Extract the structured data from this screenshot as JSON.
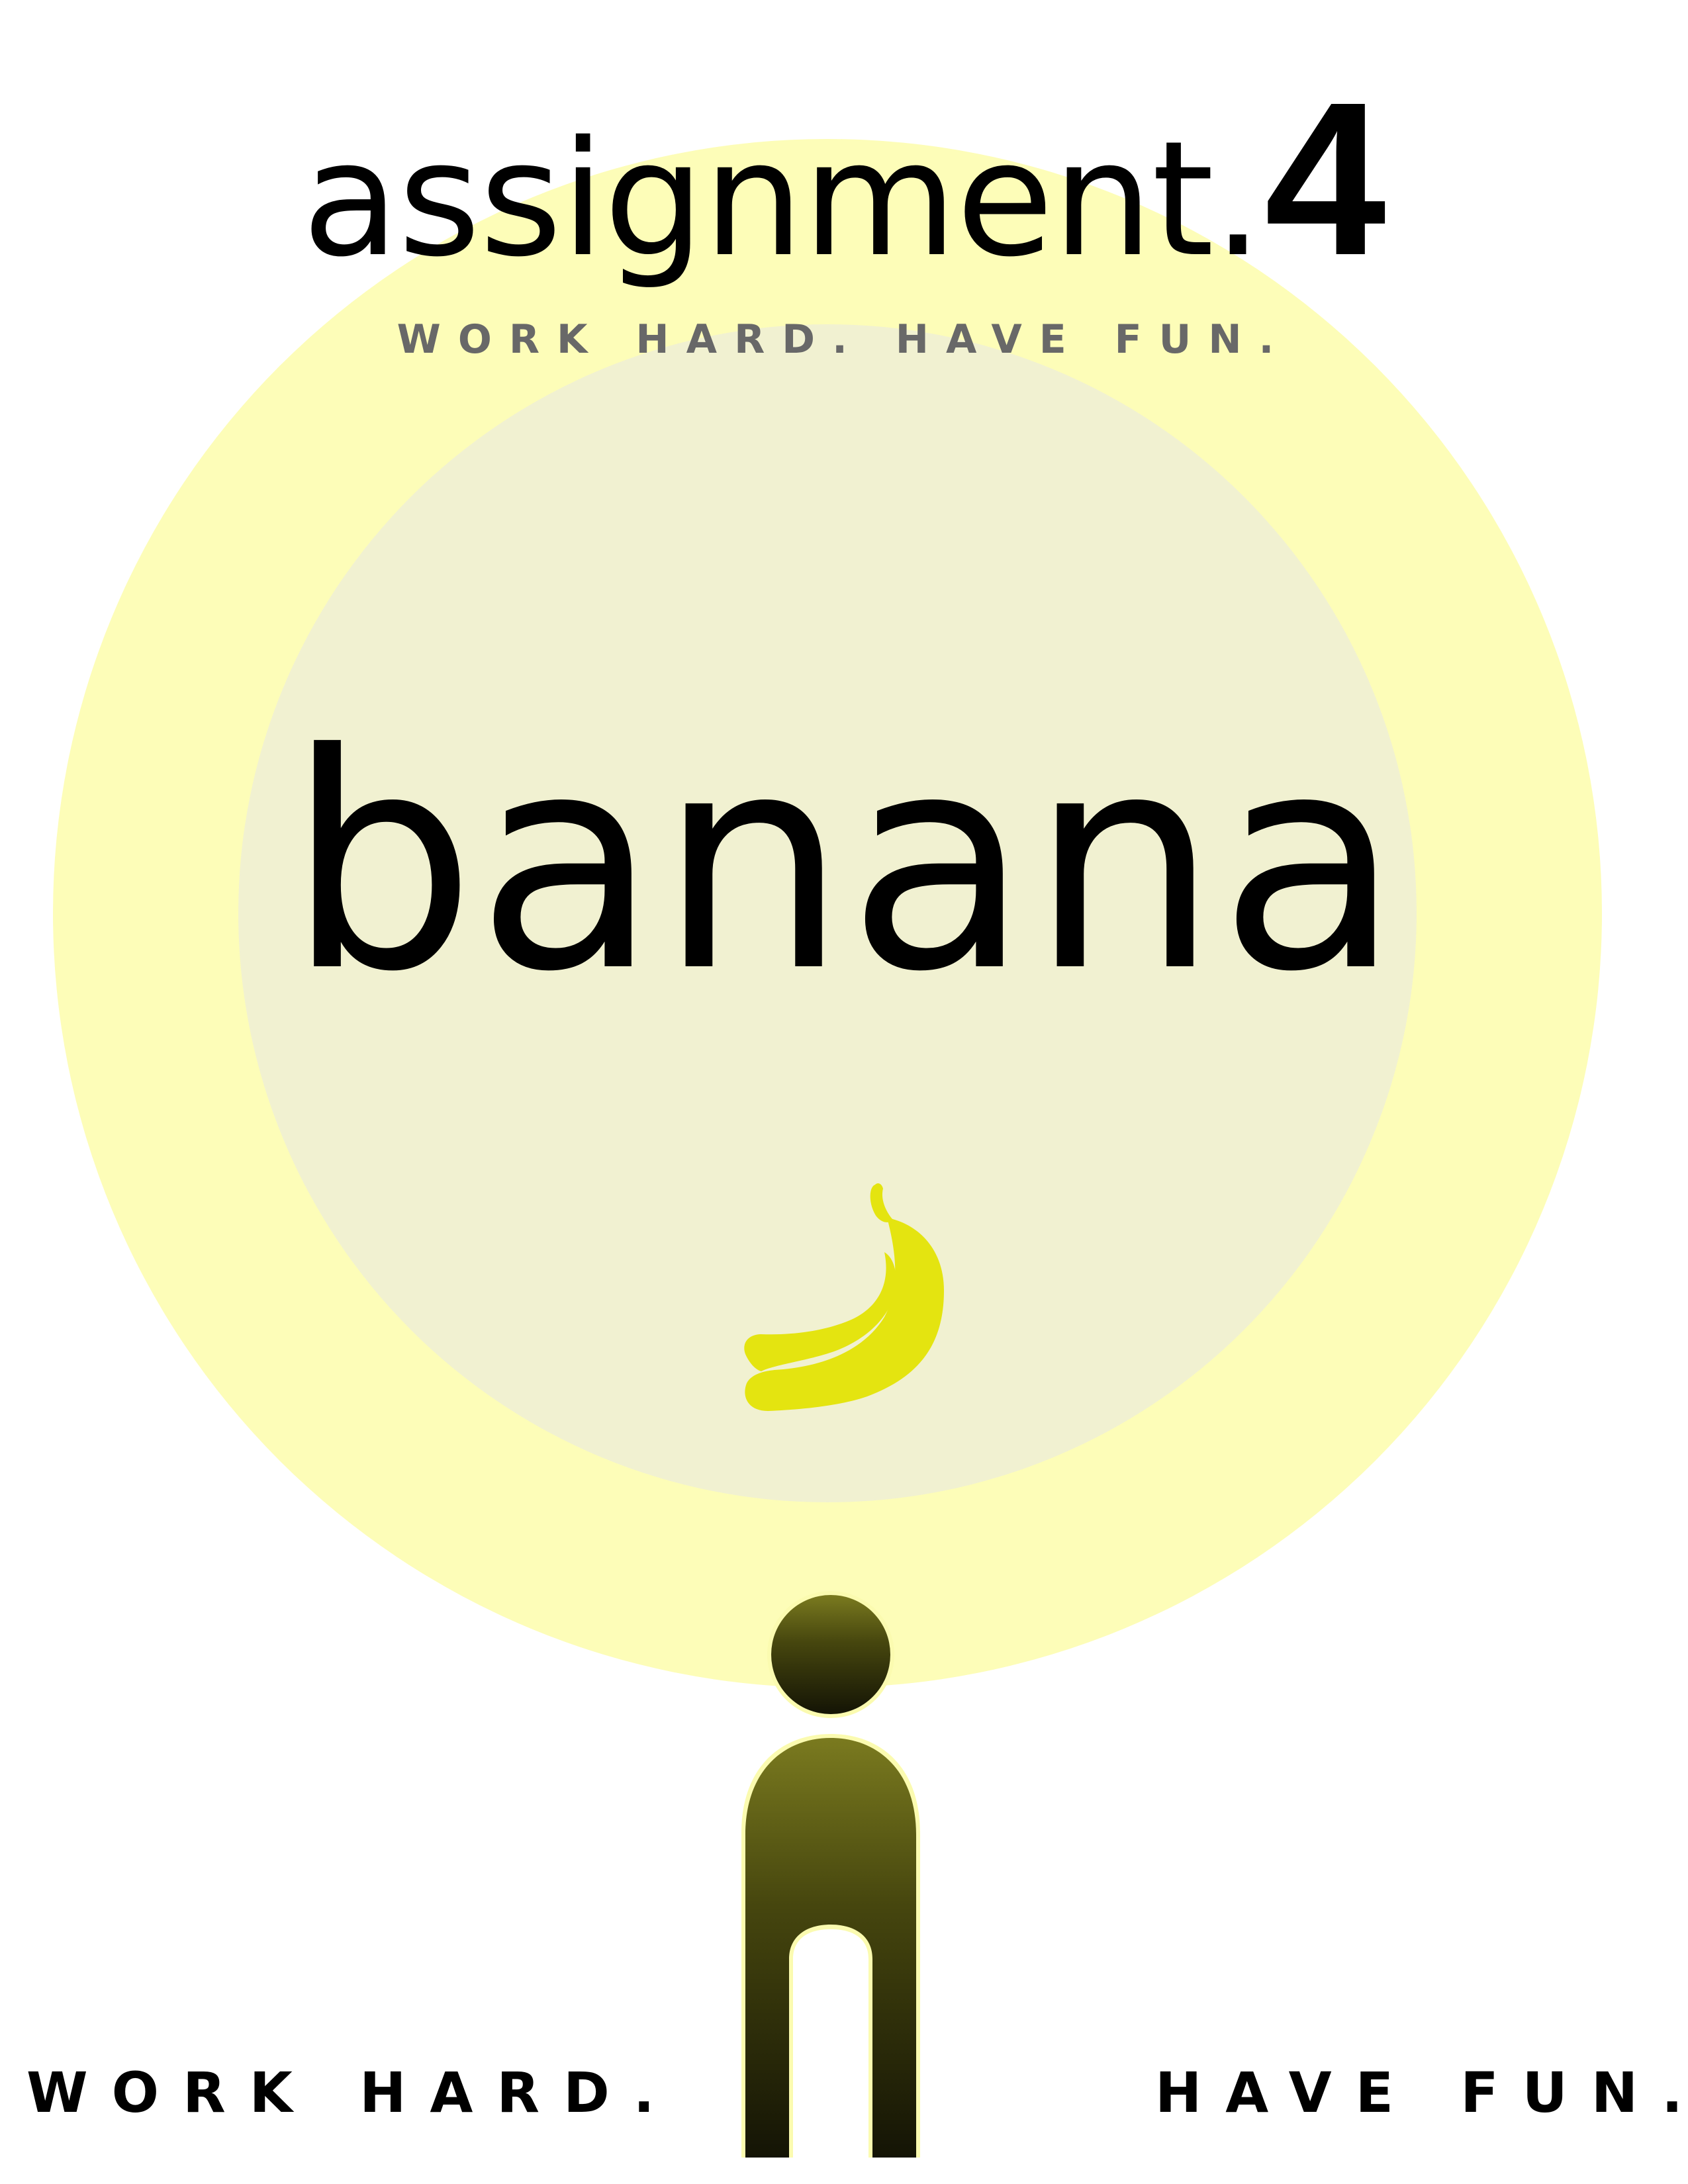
{
  "header": {
    "title_word": "assignment.",
    "title_number": "4",
    "tagline": "WORK HARD. HAVE FUN."
  },
  "main": {
    "word": "banana",
    "icon": "banana-icon"
  },
  "figure": {
    "icon": "person-icon"
  },
  "footer": {
    "left": "WORK HARD.",
    "right": "HAVE FUN."
  },
  "colors": {
    "outer_glow": "#fdfdb8",
    "inner_circle": "#f1f1d1",
    "banana": "#e4e410",
    "figure_top": "#7a7a1f",
    "figure_bottom": "#141405",
    "tagline": "#686868"
  }
}
